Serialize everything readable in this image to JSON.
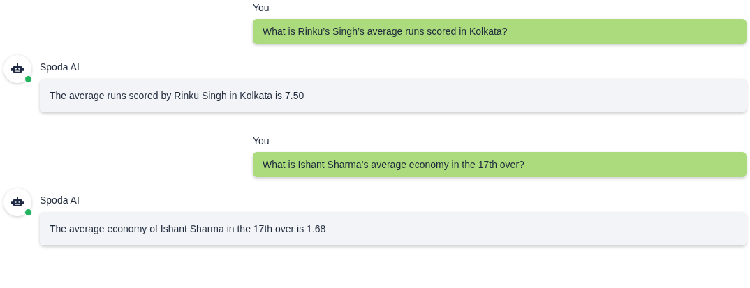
{
  "messages": [
    {
      "kind": "user",
      "sender": "You",
      "text": "What is Rinku’s Singh’s average runs scored in Kolkata?"
    },
    {
      "kind": "bot",
      "sender": "Spoda AI",
      "online": true,
      "text": "The average runs scored by Rinku Singh in Kolkata is 7.50"
    },
    {
      "kind": "user",
      "sender": "You",
      "text": "What is Ishant Sharma’s average economy in the 17th over?"
    },
    {
      "kind": "bot",
      "sender": "Spoda AI",
      "online": true,
      "text": "The average economy of Ishant Sharma in the 17th over is 1.68"
    }
  ]
}
